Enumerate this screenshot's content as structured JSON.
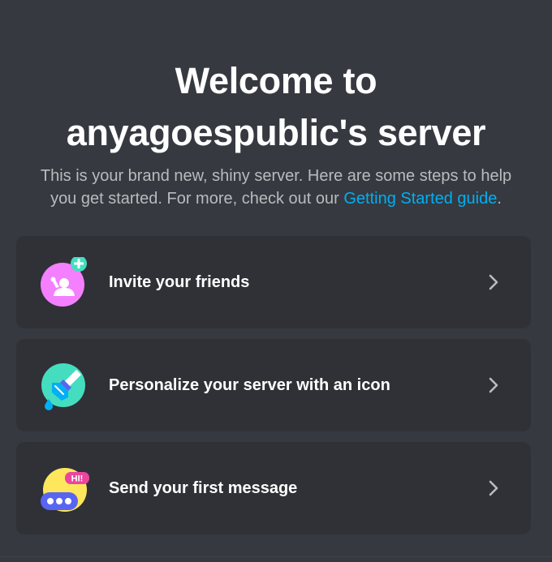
{
  "welcome": {
    "title_line1": "Welcome to",
    "title_line2": "anyagoespublic's server",
    "subtitle_line1": "This is your brand new, shiny server. Here are some steps to help",
    "subtitle_line2_prefix": "you get started. For more, check out our ",
    "subtitle_link": "Getting Started guide",
    "subtitle_line2_suffix": "."
  },
  "cards": [
    {
      "label": "Invite your friends",
      "icon": "invite-friends-icon"
    },
    {
      "label": "Personalize your server with an icon",
      "icon": "personalize-brush-icon"
    },
    {
      "label": "Send your first message",
      "icon": "message-bubble-icon",
      "badge": "HI!"
    }
  ],
  "chevron_icon": "chevron-right-icon",
  "colors": {
    "background": "#36393f",
    "card": "#2f3136",
    "link": "#00aff4",
    "subtitle": "#b9bbbe",
    "invite_icon": "#f47fff",
    "personalize_icon": "#45ddc0",
    "message_icon": "#fee75c",
    "message_bubble": "#5865f2"
  }
}
